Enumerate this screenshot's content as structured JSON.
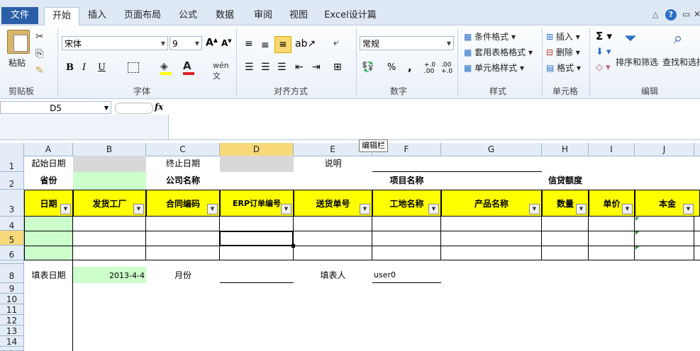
{
  "ribbon_tabs": {
    "file": "文件",
    "home": "开始",
    "insert": "插入",
    "layout": "页面布局",
    "formulas": "公式",
    "data": "数据",
    "review": "审阅",
    "view": "视图",
    "excel_design": "Excel设计篇"
  },
  "clipboard": {
    "paste": "粘贴",
    "group": "剪贴板"
  },
  "font": {
    "name": "宋体",
    "size": "9",
    "group": "字体"
  },
  "alignment": {
    "group": "对齐方式"
  },
  "number": {
    "format": "常规",
    "group": "数字",
    "percent": "%",
    "comma": ",",
    "inc": "+.0 .00",
    "dec": ".00 +.0"
  },
  "styles": {
    "conditional": "条件格式",
    "table": "套用表格格式",
    "cell": "单元格样式",
    "group": "样式"
  },
  "cells": {
    "insert": "插入",
    "delete": "删除",
    "format": "格式",
    "group": "单元格"
  },
  "editing": {
    "sort": "排序和筛选",
    "find": "查找和选择",
    "group": "编辑",
    "sum": "Σ"
  },
  "formula_bar": {
    "name_box": "D5",
    "fx": "fx",
    "tooltip": "编辑栏"
  },
  "columns": [
    "A",
    "B",
    "C",
    "D",
    "E",
    "F",
    "G",
    "H",
    "I",
    "J"
  ],
  "rows": [
    "1",
    "2",
    "3",
    "4",
    "5",
    "6",
    "8",
    "9",
    "10",
    "11",
    "12",
    "13",
    "14"
  ],
  "sheet": {
    "r1": {
      "start_date": "起始日期",
      "end_date": "终止日期",
      "note": "说明"
    },
    "r2": {
      "province": "省份",
      "company": "公司名称",
      "project": "项目名称",
      "credit": "信贷额度"
    },
    "headers": [
      "日期",
      "发货工厂",
      "合同编码",
      "ERP订单编号",
      "送货单号",
      "工地名称",
      "产品名称",
      "数量",
      "单价",
      "本金"
    ],
    "r8": {
      "fill_date_label": "填表日期",
      "fill_date": "2013-4-4",
      "month": "月份",
      "filler_label": "填表人",
      "filler": "user0"
    }
  }
}
